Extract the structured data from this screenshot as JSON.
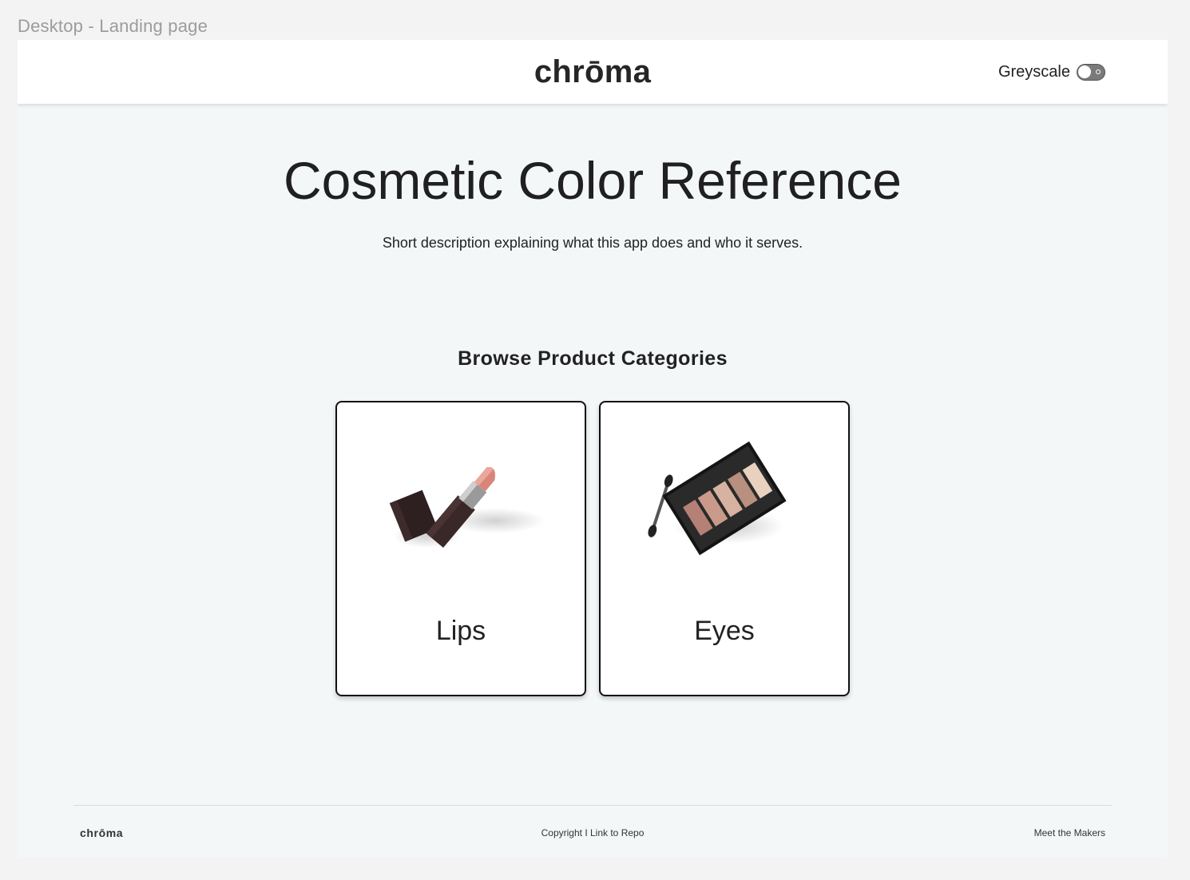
{
  "canvas": {
    "label": "Desktop - Landing page"
  },
  "header": {
    "brand": "chrōma",
    "toggle_label": "Greyscale",
    "toggle_state": "off"
  },
  "hero": {
    "title": "Cosmetic Color Reference",
    "description": "Short description explaining what this app does and who it serves."
  },
  "categories": {
    "title": "Browse Product Categories",
    "items": [
      {
        "label": "Lips",
        "icon": "lipstick-icon"
      },
      {
        "label": "Eyes",
        "icon": "eyeshadow-palette-icon"
      }
    ]
  },
  "footer": {
    "brand": "chrōma",
    "copyright": "Copyright",
    "separator": "I",
    "repo_link": "Link to Repo",
    "makers_link": "Meet the Makers"
  },
  "colors": {
    "page_bg": "#f4f7f8",
    "header_bg": "#ffffff",
    "lipstick_bullet": "#d9857a",
    "case_dark": "#2d1f1f"
  }
}
